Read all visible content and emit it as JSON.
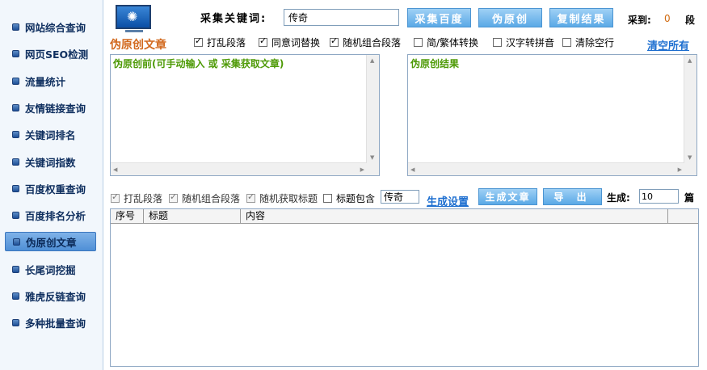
{
  "sidebar": {
    "items": [
      {
        "label": "网站综合查询"
      },
      {
        "label": "网页SEO检测"
      },
      {
        "label": "流量统计"
      },
      {
        "label": "友情链接查询"
      },
      {
        "label": "关键词排名"
      },
      {
        "label": "关键词指数"
      },
      {
        "label": "百度权重查询"
      },
      {
        "label": "百度排名分析"
      },
      {
        "label": "伪原创文章"
      },
      {
        "label": "长尾词挖掘"
      },
      {
        "label": "雅虎反链查询"
      },
      {
        "label": "多种批量查询"
      }
    ],
    "active_index": 8
  },
  "toolbar": {
    "keyword_label": "采集关键词:",
    "keyword_value": "传奇",
    "btn_collect_baidu": "采集百度",
    "btn_pseudo_original": "伪原创",
    "btn_copy_result": "复制结果",
    "collected_label": "采到:",
    "collected_count": "0",
    "collected_unit": "段"
  },
  "section": {
    "title": "伪原创文章",
    "clear_all": "清空所有"
  },
  "options": [
    {
      "label": "打乱段落",
      "checked": true
    },
    {
      "label": "同意词替换",
      "checked": true
    },
    {
      "label": "随机组合段落",
      "checked": true
    },
    {
      "label": "简/繁体转换",
      "checked": false
    },
    {
      "label": "汉字转拼音",
      "checked": false
    },
    {
      "label": "清除空行",
      "checked": false
    }
  ],
  "editors": {
    "before_placeholder": "伪原创前(可手动输入 或 采集获取文章)",
    "after_placeholder": "伪原创结果"
  },
  "generate": {
    "options": [
      {
        "label": "打乱段落",
        "checked": true
      },
      {
        "label": "随机组合段落",
        "checked": true
      },
      {
        "label": "随机获取标题",
        "checked": true
      },
      {
        "label": "标题包含",
        "checked": false
      }
    ],
    "title_contains_value": "传奇",
    "settings_link": "生成设置",
    "btn_generate": "生成文章",
    "btn_export": "导 出",
    "count_label": "生成:",
    "count_value": "10",
    "count_unit": "篇"
  },
  "table": {
    "columns": [
      "序号",
      "标题",
      "内容"
    ]
  },
  "colors": {
    "accent_blue": "#5aa9e6",
    "title_orange": "#d2691e",
    "editor_text_green": "#4e9a06",
    "link_blue": "#1e6fd0"
  }
}
